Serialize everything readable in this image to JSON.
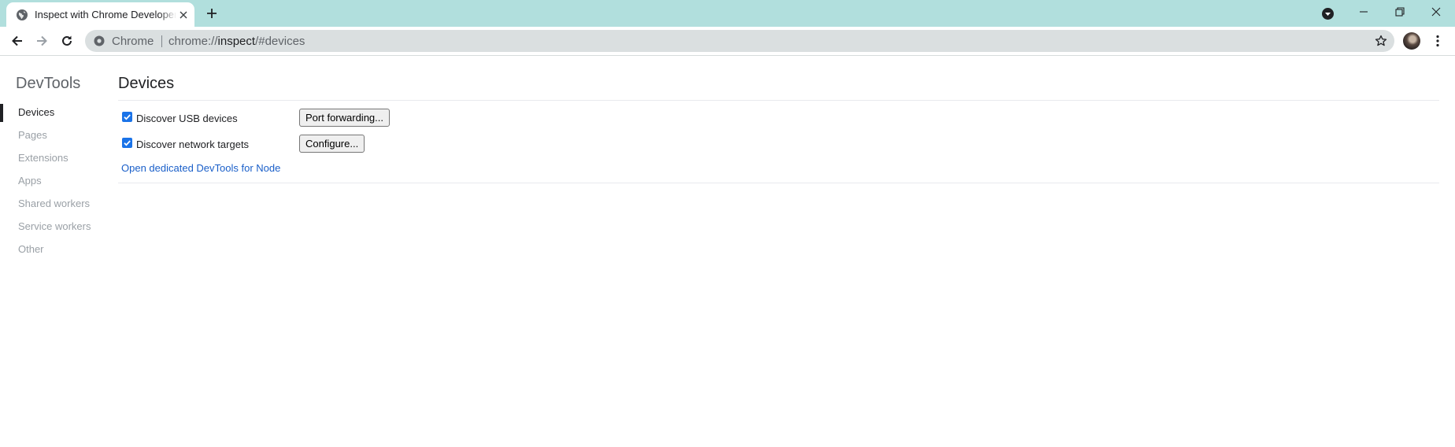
{
  "browser": {
    "tab": {
      "title": "Inspect with Chrome Developer Tools",
      "favicon": "globe-icon",
      "close_icon": "close-icon"
    },
    "new_tab_icon": "plus-icon",
    "window_controls": [
      "minimize-icon",
      "restore-icon",
      "close-icon"
    ],
    "toolbar": {
      "back_icon": "back-arrow-icon",
      "forward_icon": "forward-arrow-icon",
      "reload_icon": "reload-icon",
      "omnibox": {
        "chip": "Chrome",
        "url_scheme": "chrome://",
        "url_host": "inspect",
        "url_path": "/#devices"
      },
      "bookmark_icon": "star-icon",
      "menu_icon": "kebab-menu-icon"
    },
    "colors": {
      "tabstrip": "#b1dfdd",
      "omnibox": "#dadfe0",
      "link": "#1a5fc9",
      "checkbox": "#1a73e8"
    }
  },
  "sidebar": {
    "title": "DevTools",
    "items": [
      {
        "label": "Devices",
        "selected": true
      },
      {
        "label": "Pages"
      },
      {
        "label": "Extensions"
      },
      {
        "label": "Apps"
      },
      {
        "label": "Shared workers"
      },
      {
        "label": "Service workers"
      },
      {
        "label": "Other"
      }
    ]
  },
  "main": {
    "title": "Devices",
    "options": [
      {
        "label": "Discover USB devices",
        "checked": true,
        "button": "Port forwarding..."
      },
      {
        "label": "Discover network targets",
        "checked": true,
        "button": "Configure..."
      }
    ],
    "node_link": "Open dedicated DevTools for Node"
  }
}
